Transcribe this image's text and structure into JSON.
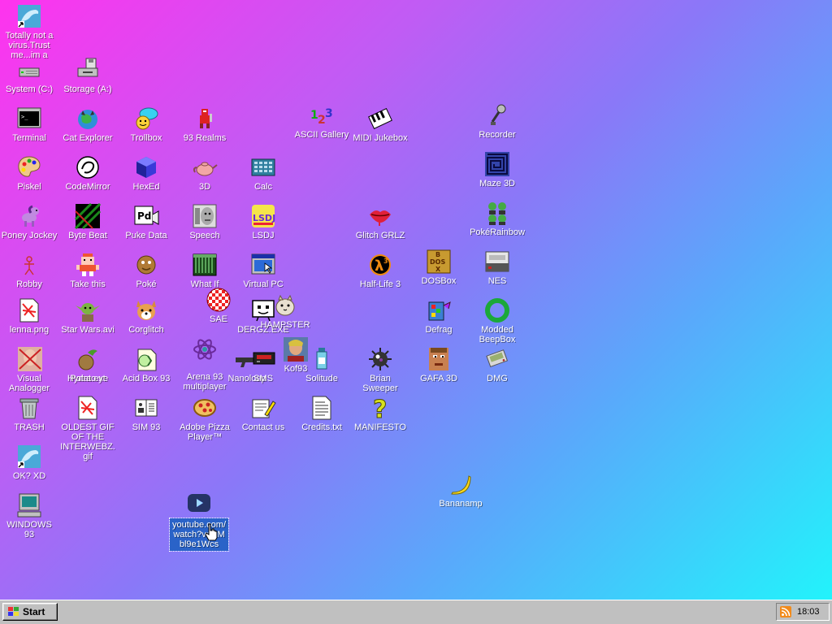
{
  "desktop": {
    "icons": [
      {
        "label": "Totally not a virus.Trust me...im a dolphin",
        "icon": "dolphin-shortcut-icon"
      },
      {
        "label": "System (C:)",
        "icon": "hard-drive-icon"
      },
      {
        "label": "Storage (A:)",
        "icon": "floppy-drive-icon"
      },
      {
        "label": "Terminal",
        "icon": "terminal-icon"
      },
      {
        "label": "Cat Explorer",
        "icon": "cat-globe-icon"
      },
      {
        "label": "Trollbox",
        "icon": "chat-bubble-icon"
      },
      {
        "label": "93 Realms",
        "icon": "knight-icon"
      },
      {
        "label": "ASCII Gallery",
        "icon": "numbers-icon"
      },
      {
        "label": "MIDI Jukebox",
        "icon": "piano-icon"
      },
      {
        "label": "Recorder",
        "icon": "microphone-icon"
      },
      {
        "label": "Piskel",
        "icon": "palette-icon"
      },
      {
        "label": "CodeMirror",
        "icon": "codemirror-icon"
      },
      {
        "label": "HexEd",
        "icon": "hex-cube-icon"
      },
      {
        "label": "3D",
        "icon": "teapot-icon"
      },
      {
        "label": "Calc",
        "icon": "calculator-icon"
      },
      {
        "label": "Maze 3D",
        "icon": "maze-icon"
      },
      {
        "label": "Poney Jockey",
        "icon": "pony-icon"
      },
      {
        "label": "Byte Beat",
        "icon": "bytebeat-icon"
      },
      {
        "label": "Puke Data",
        "icon": "puke-data-icon"
      },
      {
        "label": "Speech",
        "icon": "speech-face-icon"
      },
      {
        "label": "LSDJ",
        "icon": "lsdj-icon"
      },
      {
        "label": "Glitch GRLZ",
        "icon": "lips-icon"
      },
      {
        "label": "PokéRainbow",
        "icon": "characters-icon"
      },
      {
        "label": "Robby",
        "icon": "stick-figure-icon"
      },
      {
        "label": "Take this",
        "icon": "pixel-guy-icon"
      },
      {
        "label": "Poké",
        "icon": "pokeball-icon"
      },
      {
        "label": "What If",
        "icon": "whatif-icon"
      },
      {
        "label": "Virtual PC",
        "icon": "virtual-pc-icon"
      },
      {
        "label": "Half-Life 3",
        "icon": "half-life-icon"
      },
      {
        "label": "DOSBox",
        "icon": "dosbox-icon"
      },
      {
        "label": "NES",
        "icon": "nes-icon"
      },
      {
        "label": "SAE",
        "icon": "amiga-ball-icon"
      },
      {
        "label": "DERGZ.EXE",
        "icon": "tv-face-icon"
      },
      {
        "label": "HAMPSTER",
        "icon": "hamster-icon"
      },
      {
        "label": "lenna.png",
        "icon": "image-file-icon"
      },
      {
        "label": "Star Wars.avi",
        "icon": "yoda-icon"
      },
      {
        "label": "Corglitch",
        "icon": "corgi-icon"
      },
      {
        "label": "Defrag",
        "icon": "defrag-icon"
      },
      {
        "label": "Modded BeepBox",
        "icon": "beepbox-icon"
      },
      {
        "label": "Visual Analogger",
        "icon": "portrait-icon"
      },
      {
        "label": "Hydra.exe",
        "icon": "hydra-icon"
      },
      {
        "label": "Potato.yt",
        "icon": "potato-icon"
      },
      {
        "label": "Acid Box 93",
        "icon": "acid-box-icon"
      },
      {
        "label": "Arena 93 multiplayer",
        "icon": "atom-icon"
      },
      {
        "label": "Nanoloop",
        "icon": "gun-icon"
      },
      {
        "label": "SMS",
        "icon": "cassette-icon"
      },
      {
        "label": "Kof93",
        "icon": "fighter-icon"
      },
      {
        "label": "Solitude",
        "icon": "bottle-icon"
      },
      {
        "label": "Brian Sweeper",
        "icon": "mine-icon"
      },
      {
        "label": "GAFA 3D",
        "icon": "doom-face-icon"
      },
      {
        "label": "DMG",
        "icon": "gameboy-icon"
      },
      {
        "label": "TRASH",
        "icon": "trash-icon"
      },
      {
        "label": "OLDEST GIF OF THE INTERWEBZ.gif",
        "icon": "gif-file-icon"
      },
      {
        "label": "SIM 93",
        "icon": "sim-book-icon"
      },
      {
        "label": "Adobe Pizza Player™",
        "icon": "pizza-icon"
      },
      {
        "label": "Contact us",
        "icon": "contact-icon"
      },
      {
        "label": "Credits.txt",
        "icon": "text-file-icon"
      },
      {
        "label": "MANIFESTO",
        "icon": "question-mark-icon"
      },
      {
        "label": "Bananamp",
        "icon": "banana-icon"
      },
      {
        "label": "OK? XD",
        "icon": "dolphin-shortcut-icon"
      },
      {
        "label": "WINDOWS 93",
        "icon": "computer-icon"
      },
      {
        "label": "youtube.com/watch?v=KMbl9e1Wcs",
        "icon": "youtube-icon"
      }
    ]
  },
  "taskbar": {
    "start_label": "Start",
    "clock": "18:03"
  },
  "colors": {
    "gradient_start": "#ff33ee",
    "gradient_end": "#22f3fb",
    "taskbar": "#c0c0c0",
    "selection": "#2a63c8"
  }
}
